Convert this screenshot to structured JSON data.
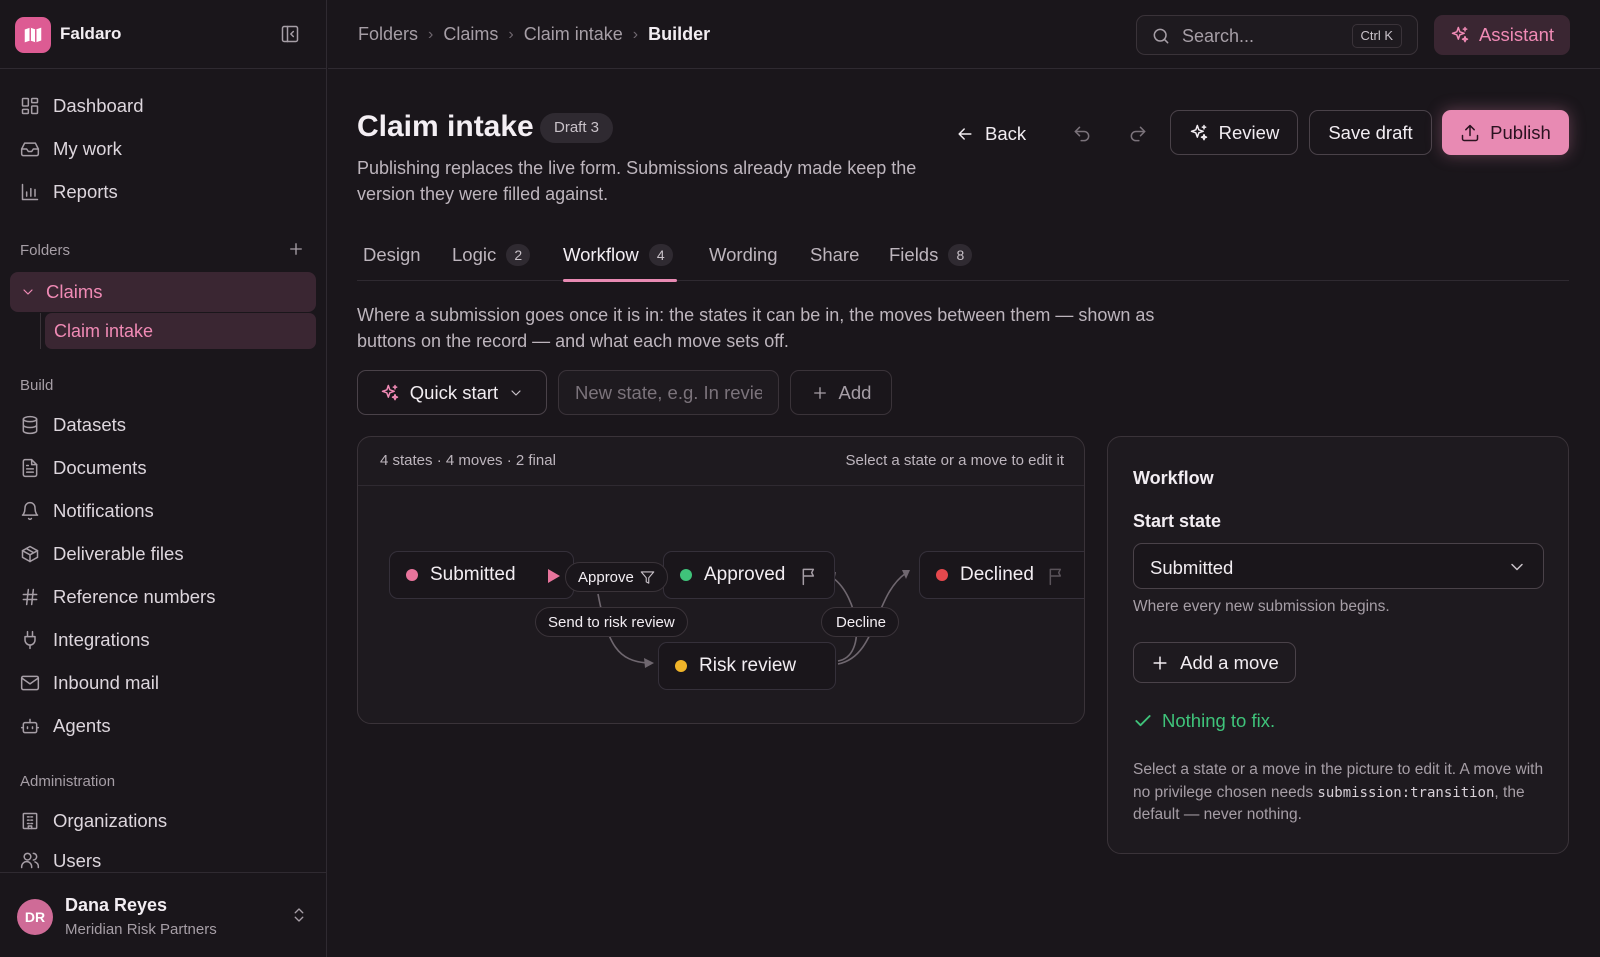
{
  "app": {
    "name": "Faldaro"
  },
  "sidebar": {
    "nav_top": [
      {
        "label": "Dashboard",
        "icon": "dashboard-icon"
      },
      {
        "label": "My work",
        "icon": "inbox-icon"
      },
      {
        "label": "Reports",
        "icon": "bar-chart-icon"
      }
    ],
    "folders_heading": "Folders",
    "folders": {
      "claims": "Claims",
      "claim_intake": "Claim intake"
    },
    "build_heading": "Build",
    "nav_build": [
      {
        "label": "Datasets",
        "icon": "database-icon"
      },
      {
        "label": "Documents",
        "icon": "document-icon"
      },
      {
        "label": "Notifications",
        "icon": "bell-icon"
      },
      {
        "label": "Deliverable files",
        "icon": "package-icon"
      },
      {
        "label": "Reference numbers",
        "icon": "hash-icon"
      },
      {
        "label": "Integrations",
        "icon": "plug-icon"
      },
      {
        "label": "Inbound mail",
        "icon": "mail-icon"
      },
      {
        "label": "Agents",
        "icon": "bot-icon"
      }
    ],
    "admin_heading": "Administration",
    "nav_admin": [
      {
        "label": "Organizations",
        "icon": "building-icon"
      },
      {
        "label": "Users",
        "icon": "users-icon"
      }
    ],
    "user": {
      "initials": "DR",
      "name": "Dana Reyes",
      "org": "Meridian Risk Partners"
    }
  },
  "topbar": {
    "breadcrumb": [
      "Folders",
      "Claims",
      "Claim intake",
      "Builder"
    ],
    "search_placeholder": "Search...",
    "search_shortcut": "Ctrl K",
    "assistant_label": "Assistant"
  },
  "header": {
    "title": "Claim intake",
    "badge": "Draft 3",
    "description": "Publishing replaces the live form. Submissions already made keep the version they were filled against.",
    "back_label": "Back",
    "review_label": "Review",
    "save_draft_label": "Save draft",
    "publish_label": "Publish"
  },
  "tabs": [
    {
      "label": "Design",
      "count": null
    },
    {
      "label": "Logic",
      "count": "2"
    },
    {
      "label": "Workflow",
      "count": "4",
      "active": true
    },
    {
      "label": "Wording",
      "count": null
    },
    {
      "label": "Share",
      "count": null
    },
    {
      "label": "Fields",
      "count": "8"
    }
  ],
  "workflow": {
    "description": "Where a submission goes once it is in: the states it can be in, the moves between them — shown as buttons on the record — and what each move sets off.",
    "quick_start_label": "Quick start",
    "new_state_placeholder": "New state, e.g. In review",
    "add_label": "Add",
    "canvas": {
      "stats": "4 states · 4 moves · 2 final",
      "hint": "Select a state or a move to edit it",
      "states": [
        {
          "label": "Submitted",
          "color": "#e8749c"
        },
        {
          "label": "Approved",
          "color": "#3fc37a"
        },
        {
          "label": "Declined",
          "color": "#e5484d"
        },
        {
          "label": "Risk review",
          "color": "#f0b429"
        }
      ],
      "moves": {
        "approve": "Approve",
        "send_to_risk_review": "Send to risk review",
        "decline": "Decline"
      }
    }
  },
  "panel": {
    "title": "Workflow",
    "start_state_label": "Start state",
    "start_state_value": "Submitted",
    "start_state_help": "Where every new submission begins.",
    "add_move_label": "Add a move",
    "status": "Nothing to fix.",
    "note_before": "Select a state or a move in the picture to edit it. A move with no privilege chosen needs ",
    "note_code": "submission:transition",
    "note_after": ", the default — never nothing."
  },
  "colors": {
    "accent": "#e88ab3",
    "success": "#3fc37a",
    "background": "#1a161b"
  }
}
